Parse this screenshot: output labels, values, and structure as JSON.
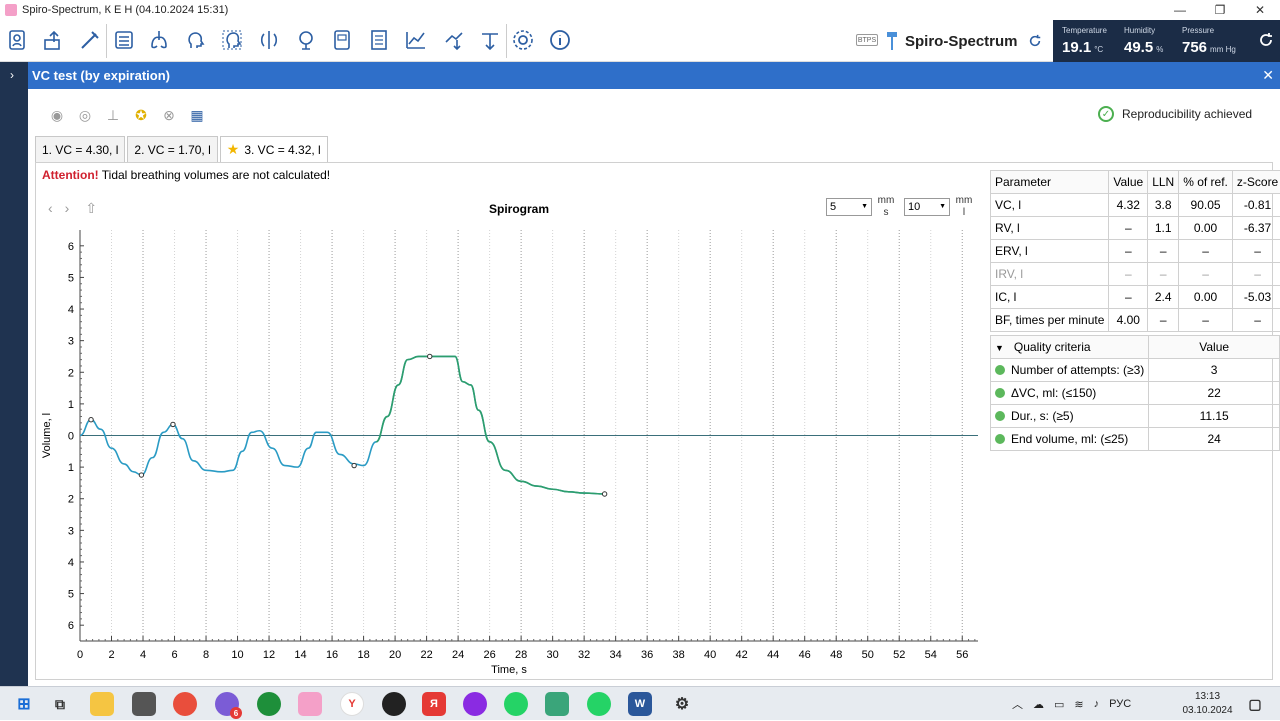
{
  "window": {
    "title": "Spiro-Spectrum, К Е Н (04.10.2024 15:31)",
    "minimize": "—",
    "maximize": "❐",
    "close": "✕"
  },
  "brand": {
    "btps": "BTPS",
    "name": "Spiro-Spectrum"
  },
  "env": {
    "temperature": {
      "label": "Temperature",
      "value": "19.1",
      "unit": "°C"
    },
    "humidity": {
      "label": "Humidity",
      "value": "49.5",
      "unit": "%"
    },
    "pressure": {
      "label": "Pressure",
      "value": "756",
      "unit": "mm Hg"
    }
  },
  "header": {
    "title": "VC test (by expiration)",
    "close": "✕"
  },
  "reproducibility": "Reproducibility achieved",
  "tabs": [
    {
      "label": "1. VC = 4.30, l",
      "starred": false
    },
    {
      "label": "2. VC = 1.70, l",
      "starred": false
    },
    {
      "label": "3. VC = 4.32, l",
      "starred": true
    }
  ],
  "attention": {
    "prefix": "Attention!",
    "text": "Tidal breathing volumes are not calculated!"
  },
  "scale": {
    "x_value": "5",
    "x_unit_top": "mm",
    "x_unit_bottom": "s",
    "y_value": "10",
    "y_unit_top": "mm",
    "y_unit_bottom": "l"
  },
  "chart_data": {
    "type": "line",
    "title": "Spirogram",
    "xlabel": "Time, s",
    "ylabel": "Volume, l",
    "xlim": [
      0,
      57
    ],
    "ylim": [
      -6.5,
      6.5
    ],
    "x_ticks": [
      0,
      2,
      4,
      6,
      8,
      10,
      12,
      14,
      16,
      18,
      20,
      22,
      24,
      26,
      28,
      30,
      32,
      34,
      36,
      38,
      40,
      42,
      44,
      46,
      48,
      50,
      52,
      54,
      56
    ],
    "y_ticks": [
      -6,
      -5,
      -4,
      -3,
      -2,
      -1,
      0,
      1,
      2,
      3,
      4,
      5,
      6
    ],
    "y_tick_labels": [
      "6",
      "5",
      "4",
      "3",
      "2",
      "1",
      "0",
      "1",
      "2",
      "3",
      "4",
      "5",
      "6"
    ],
    "grid": true,
    "series": [
      {
        "color": "#2a9bc4",
        "x": [
          0,
          0.7,
          1.3,
          2,
          2.8,
          3.4,
          3.9,
          4.6,
          5.3,
          5.9,
          6.5,
          7.2,
          8,
          9,
          9.7,
          10.3,
          10.9,
          11.4,
          12.2,
          13,
          13.8,
          14.5,
          15,
          15.7,
          16.5,
          17.4,
          18,
          18.8,
          19.5,
          20.2,
          20.8,
          21.5,
          22.2,
          23,
          23.8,
          24.3,
          24.8,
          25.3,
          26,
          27,
          28,
          29,
          30,
          31,
          32,
          33.3
        ],
        "y": [
          0,
          -0.5,
          -0.2,
          0.4,
          0.9,
          1.15,
          1.25,
          0.7,
          -0.1,
          -0.35,
          0.1,
          0.8,
          1.1,
          1.15,
          1.1,
          0.5,
          -0.1,
          -0.15,
          0.4,
          0.95,
          1,
          0.4,
          -0.1,
          -0.1,
          0.6,
          0.9,
          0.95,
          0.2,
          -0.6,
          -1.6,
          -2.4,
          -2.5,
          -2.5,
          -2.5,
          -2.5,
          -1.7,
          -1.6,
          -0.8,
          0.2,
          1.1,
          1.45,
          1.6,
          1.7,
          1.78,
          1.82,
          1.85
        ]
      }
    ],
    "markers": [
      {
        "x": 0.7,
        "y": -0.5
      },
      {
        "x": 3.9,
        "y": 1.25
      },
      {
        "x": 5.9,
        "y": -0.35
      },
      {
        "x": 17.4,
        "y": 0.95
      },
      {
        "x": 22.2,
        "y": -2.5
      },
      {
        "x": 33.3,
        "y": 1.85
      }
    ]
  },
  "param_table": {
    "headers": [
      "Parameter",
      "Value",
      "LLN",
      "% of ref.",
      "z-Score"
    ],
    "rows": [
      [
        "VC, l",
        "4.32",
        "3.8",
        "90.05",
        "-0.81"
      ],
      [
        "RV, l",
        "–",
        "1.1",
        "0.00",
        "-6.37"
      ],
      [
        "ERV, l",
        "–",
        "–",
        "–",
        "–"
      ],
      [
        "IRV, l",
        "–",
        "–",
        "–",
        "–"
      ],
      [
        "IC, l",
        "–",
        "2.4",
        "0.00",
        "-5.03"
      ],
      [
        "BF, times per minute",
        "4.00",
        "–",
        "–",
        "–"
      ]
    ]
  },
  "quality": {
    "header_label": "Quality criteria",
    "header_value": "Value",
    "rows": [
      [
        "Number of attempts: (≥3)",
        "3"
      ],
      [
        "ΔVC, ml: (≤150)",
        "22"
      ],
      [
        "Dur., s: (≥5)",
        "11.15"
      ],
      [
        "End volume, ml: (≤25)",
        "24"
      ]
    ]
  },
  "taskbar": {
    "lang": "РУС",
    "time": "13:13",
    "date": "03.10.2024",
    "badge": "6",
    "yandex": "Я"
  }
}
